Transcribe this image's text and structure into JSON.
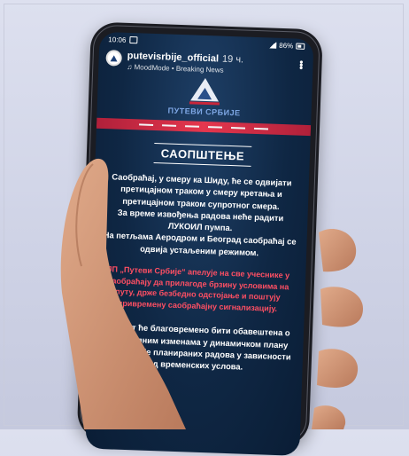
{
  "status_bar": {
    "time": "10:06",
    "signal": ".ıl.ıl",
    "battery": "86%"
  },
  "post": {
    "username": "putevisrbije_official",
    "time_ago": "19 ч.",
    "subtitle": "MoodMode • Breaking News",
    "avatar_icon": "triangle-logo-icon",
    "menu_icon": "more-dots-icon"
  },
  "logo": {
    "text": "ПУТЕВИ СРБИЈЕ"
  },
  "notice": {
    "title": "САОПШТЕЊЕ",
    "para1": "Саобраћај, у смеру ка Шиду, ће се одвијати претицајном траком у смеру кретања и претицајном траком супротног смера.",
    "para2": "За време извођења радова неће радити ЛУКОИЛ пумпа.",
    "para3": "На петљама Аеродром и Београд саобраћај се одвија устаљеним режимом.",
    "red": "ЈП „Путеви Србије“ апелује на све учеснике у саобраћају да прилагоде брзину условима на путу, држе безбедно одстојање и поштују привремену саобраћајну сигнализацију.",
    "closing": "Јавност ће благовремено бити обавештена о евентуалним изменама у динамичком плану реализације планираних радова у зависности од временских услова."
  },
  "colors": {
    "screen_bg": "#0f2744",
    "accent_red": "#e5374e",
    "red_text": "#ff4f63"
  }
}
